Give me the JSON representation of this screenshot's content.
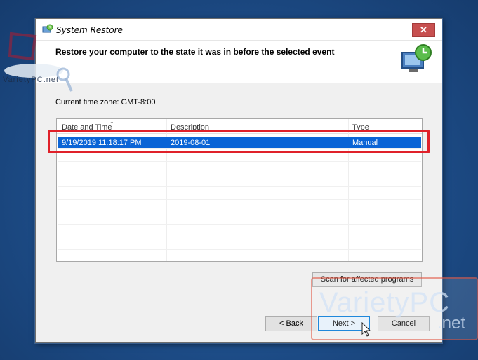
{
  "window": {
    "title": "System Restore",
    "close_label": "✕"
  },
  "header": {
    "title": "Restore your computer to the state it was in before the selected event"
  },
  "timezone_label": "Current time zone: GMT-8:00",
  "table": {
    "columns": [
      "Date and Time",
      "Description",
      "Type"
    ],
    "rows": [
      {
        "date": "9/19/2019 11:18:17 PM",
        "description": "2019-08-01",
        "type": "Manual",
        "selected": true
      }
    ]
  },
  "buttons": {
    "scan": "Scan for affected programs",
    "back": "< Back",
    "next": "Next >",
    "cancel": "Cancel"
  },
  "watermarks": {
    "left_text": "VarietyPC.net",
    "right_main": "VarietyPC",
    "right_domain": ".net"
  },
  "colors": {
    "selection": "#0a64d6",
    "highlight": "#e0212a",
    "close": "#c75050"
  },
  "icons": [
    "system-restore-icon",
    "close-icon",
    "restore-monitor-icon",
    "sort-arrow-icon",
    "mouse-cursor-icon"
  ]
}
